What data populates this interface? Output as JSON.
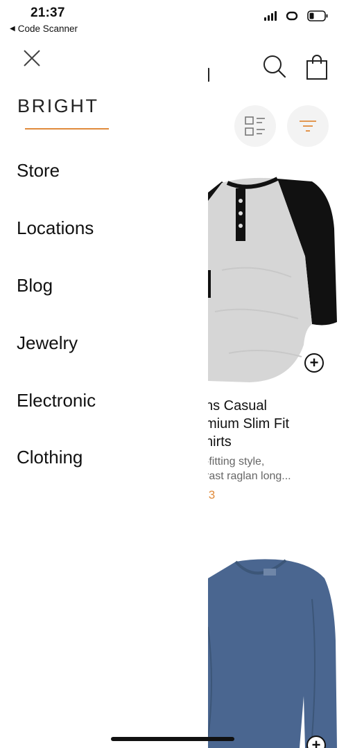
{
  "status_bar": {
    "time": "21:37",
    "back_app": "Code Scanner"
  },
  "drawer": {
    "brand": "BRIGHT",
    "items": [
      {
        "label": "Store"
      },
      {
        "label": "Locations"
      },
      {
        "label": "Blog"
      },
      {
        "label": "Jewelry"
      },
      {
        "label": "Electronic"
      },
      {
        "label": "Clothing"
      }
    ]
  },
  "product_list": {
    "products": [
      {
        "title_lines": [
          "ns Casual",
          "mium Slim Fit",
          "hirts"
        ],
        "desc_lines": [
          "-fitting style,",
          "rast raglan long..."
        ],
        "price": ".3"
      },
      {
        "title_lines": [],
        "desc_lines": [],
        "price": ""
      }
    ]
  },
  "colors": {
    "accent": "#e08a3a",
    "shirt_grey": "#d9d9d9",
    "shirt_blue": "#4a6690",
    "text_dark": "#111111"
  },
  "icons": [
    "close-icon",
    "search-icon",
    "bag-icon",
    "list-view-icon",
    "filter-icon",
    "plus-icon",
    "link-icon",
    "battery-icon",
    "signal-icon"
  ]
}
